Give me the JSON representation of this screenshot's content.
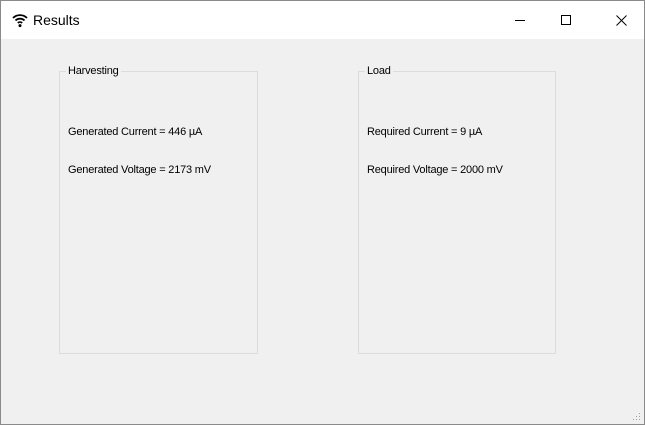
{
  "window": {
    "title": "Results",
    "icon": "wifi-icon",
    "controls": [
      "minimize-icon",
      "maximize-icon",
      "close-icon"
    ]
  },
  "harvesting": {
    "legend": "Harvesting",
    "current_text": "Generated Current = 446 µA",
    "voltage_text": "Generated Voltage = 2173 mV"
  },
  "load": {
    "legend": "Load",
    "current_text": "Required Current = 9 µA",
    "voltage_text": "Required Voltage = 2000 mV"
  },
  "colors": {
    "titlebar": "#ffffff",
    "client": "#f0f0f0",
    "groupbox_border": "#dcdcdc"
  }
}
